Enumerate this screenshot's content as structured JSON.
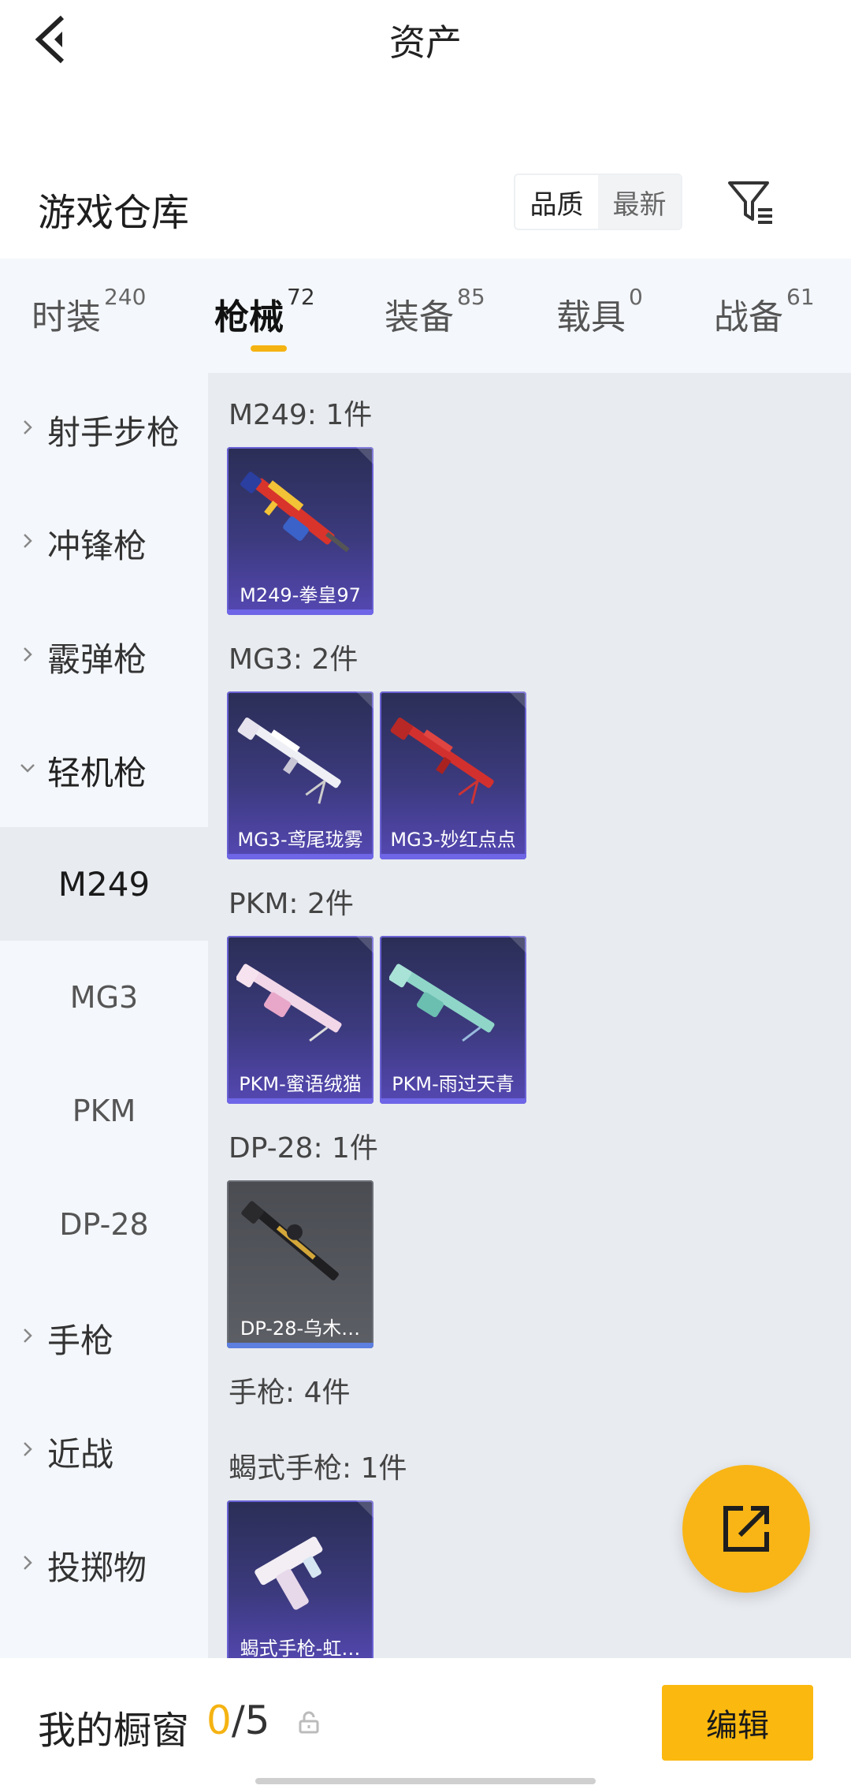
{
  "header": {
    "title": "资产"
  },
  "warehouse": {
    "title": "游戏仓库",
    "sort_options": [
      "品质",
      "最新"
    ],
    "active_sort": "品质"
  },
  "categories": [
    {
      "label": "时装",
      "count": "240"
    },
    {
      "label": "枪械",
      "count": "72",
      "active": true
    },
    {
      "label": "装备",
      "count": "85"
    },
    {
      "label": "载具",
      "count": "0"
    },
    {
      "label": "战备",
      "count": "61"
    }
  ],
  "sidebar": {
    "items": [
      {
        "label": "射手步枪",
        "expanded": false
      },
      {
        "label": "冲锋枪",
        "expanded": false
      },
      {
        "label": "霰弹枪",
        "expanded": false
      },
      {
        "label": "轻机枪",
        "expanded": true
      },
      {
        "label": "手枪",
        "expanded": false
      },
      {
        "label": "近战",
        "expanded": false
      },
      {
        "label": "投掷物",
        "expanded": false
      }
    ],
    "subitems": [
      {
        "label": "M249",
        "active": true
      },
      {
        "label": "MG3"
      },
      {
        "label": "PKM"
      },
      {
        "label": "DP-28"
      }
    ]
  },
  "groups": [
    {
      "title": "M249: 1件",
      "items": [
        {
          "name": "M249-拳皇97",
          "tier": "purple",
          "icon": "lmg-red-icon"
        }
      ]
    },
    {
      "title": "MG3: 2件",
      "items": [
        {
          "name": "MG3-鸢尾珑雾",
          "tier": "purple",
          "icon": "lmg-white-icon"
        },
        {
          "name": "MG3-妙红点点",
          "tier": "purple",
          "icon": "lmg-red-icon"
        }
      ]
    },
    {
      "title": "PKM: 2件",
      "items": [
        {
          "name": "PKM-蜜语绒猫",
          "tier": "purple",
          "icon": "lmg-pink-icon"
        },
        {
          "name": "PKM-雨过天青",
          "tier": "purple",
          "icon": "lmg-teal-icon"
        }
      ]
    },
    {
      "title": "DP-28: 1件",
      "items": [
        {
          "name": "DP-28-乌木…",
          "tier": "gray",
          "icon": "lmg-black-gold-icon"
        }
      ]
    },
    {
      "title": "手枪: 4件",
      "items": []
    },
    {
      "title": "蝎式手枪: 1件",
      "items": [
        {
          "name": "蝎式手枪-虹…",
          "tier": "purple",
          "icon": "pistol-white-icon"
        }
      ]
    }
  ],
  "showcase": {
    "label": "我的橱窗",
    "used": "0",
    "separator": "/",
    "total": "5"
  },
  "edit_button": {
    "label": "编辑"
  },
  "colors": {
    "accent": "#f5b312",
    "card_purple": "#3c3a7e",
    "card_gray": "#55575e",
    "sidebar_bg": "#f4f7fb",
    "content_bg": "#e8ebf0"
  }
}
